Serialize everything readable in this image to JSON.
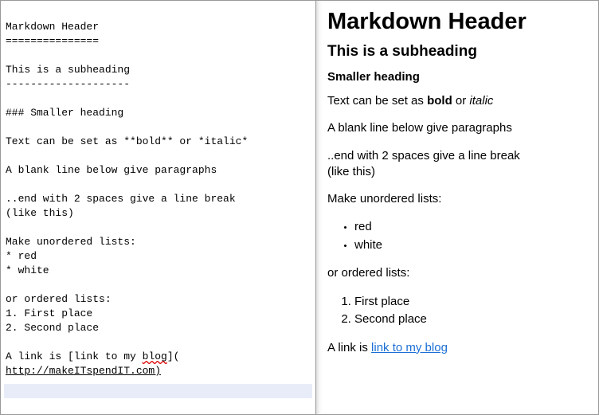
{
  "source": {
    "l1": "Markdown Header",
    "l2": "===============",
    "l3": "This is a subheading",
    "l4": "--------------------",
    "l5": "### Smaller heading",
    "l6": "Text can be set as **bold** or *italic*",
    "l7": "A blank line below give paragraphs",
    "l8": "..end with 2 spaces give a line break  ",
    "l9": "(like this)",
    "l10": "Make unordered lists:",
    "l11": "* red",
    "l12": "* white",
    "l13": "or ordered lists:",
    "l14": "1. First place",
    "l15": "2. Second place",
    "l16a": "A link is [link to my ",
    "l16b": "blog",
    "l16c": "](",
    "l17": "http://makeITspendIT.com)"
  },
  "preview": {
    "h1": "Markdown Header",
    "h2": "This is a subheading",
    "h3": "Smaller heading",
    "p1a": "Text can be set as ",
    "p1b": "bold",
    "p1c": " or ",
    "p1d": "italic",
    "p2": "A blank line below give paragraphs",
    "p3a": "..end with 2 spaces give a line break",
    "p3b": "(like this)",
    "p4": "Make unordered lists:",
    "ul1": "red",
    "ul2": "white",
    "p5": "or ordered lists:",
    "ol1": "First place",
    "ol2": "Second place",
    "p6a": "A link is ",
    "link_text": "link to my blog",
    "link_href": "http://makeITspendIT.com"
  }
}
